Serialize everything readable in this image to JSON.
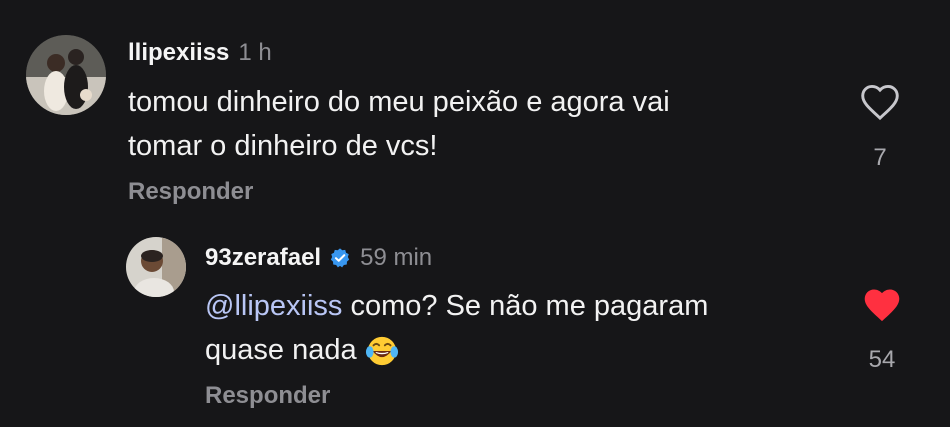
{
  "comments": [
    {
      "username": "llipexiiss",
      "time": "1 h",
      "text_lines": [
        "tomou dinheiro do meu peixão e agora vai",
        "tomar o dinheiro de vcs!"
      ],
      "reply_label": "Responder",
      "like_count": "7",
      "liked": false
    },
    {
      "username": "93zerafael",
      "verified": true,
      "time": "59 min",
      "mention": "@llipexiiss",
      "text_line1_rest": " como? Se não me pagaram",
      "text_line2": "quase nada",
      "emoji": "face-with-tears-of-joy",
      "reply_label": "Responder",
      "like_count": "54",
      "liked": true
    }
  ],
  "colors": {
    "background": "#161618",
    "muted": "#8e8e93",
    "mention": "#b9c6f5",
    "like_active": "#ff3040",
    "verified": "#3897f0"
  }
}
